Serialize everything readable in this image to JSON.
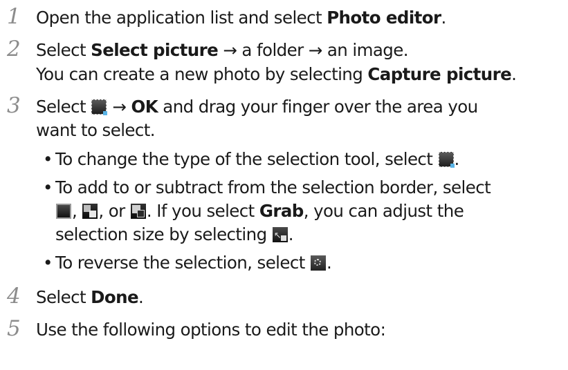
{
  "steps": [
    {
      "num": "1",
      "pre": "Open the application list and select ",
      "bold": "Photo editor",
      "post": "."
    },
    {
      "num": "2",
      "pre": "Select ",
      "bold": "Select picture",
      "post": " → a folder → an image.",
      "line2_pre": "You can create a new photo by selecting ",
      "line2_bold": "Capture picture",
      "line2_post": "."
    },
    {
      "num": "3",
      "pre": "Select ",
      "arrow": " → ",
      "bold": "OK",
      "post": " and drag your finger over the area you",
      "line2": "want to select."
    },
    {
      "num": "4",
      "pre": "Select ",
      "bold": "Done",
      "post": "."
    },
    {
      "num": "5",
      "text": "Use the following options to edit the photo:"
    }
  ],
  "bullets": [
    {
      "dot": "•",
      "text": "To change the type of the selection tool, select ",
      "end": "."
    },
    {
      "dot": "•",
      "text": "To add to or subtract from the selection border, select",
      "line2_sep1": ", ",
      "line2_sep2": ", or ",
      "line2_pre": ". If you select ",
      "line2_bold": "Grab",
      "line2_post": ", you can adjust the",
      "line3": "selection size by selecting ",
      "line3_end": "."
    },
    {
      "dot": "•",
      "text": "To reverse the selection, select ",
      "end": "."
    }
  ],
  "icons": {
    "selection_tool": "selection-tool-icon",
    "new_selection": "new-selection-icon",
    "add_selection": "add-selection-icon",
    "subtract_selection": "subtract-selection-icon",
    "selection_size": "selection-size-icon",
    "reverse_selection": "reverse-selection-icon"
  }
}
